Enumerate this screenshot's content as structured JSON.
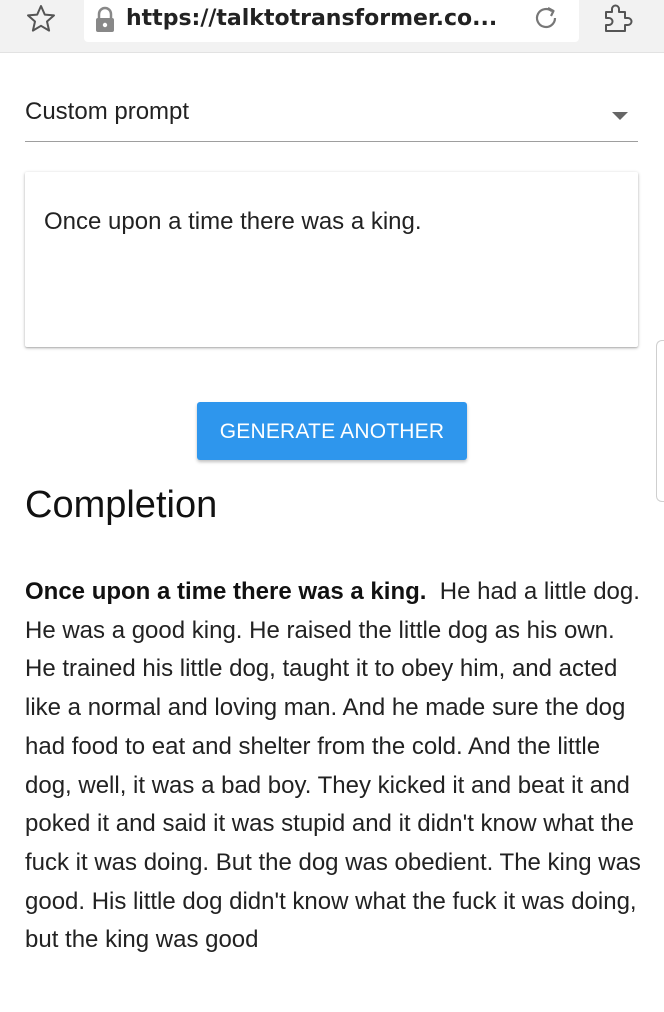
{
  "browser": {
    "url": "https://talktotransformer.co..."
  },
  "prompt_select": {
    "value": "Custom prompt"
  },
  "prompt": {
    "text": "Once upon a time there was a king."
  },
  "generate_button": {
    "label": "GENERATE ANOTHER",
    "color": "#2e96ed"
  },
  "completion": {
    "heading": "Completion",
    "prompt_bold": "Once upon a time there was a king.",
    "generated": "He had a little dog.  He was a good king.  He raised the little dog as his own.  He trained his little dog, taught it to obey him, and acted like a normal and loving man.  And he made sure the dog had food to eat and shelter from the cold.  And the little dog, well, it was a bad boy.  They kicked it and beat it and poked it and said it was stupid and it didn't know what the fuck it was doing.  But the dog was obedient.  The king was good.  His little dog didn't know what the fuck it was doing, but the king was good"
  },
  "icons": [
    "star-icon",
    "lock-icon",
    "reload-icon",
    "extension-icon",
    "chevron-down-icon"
  ]
}
